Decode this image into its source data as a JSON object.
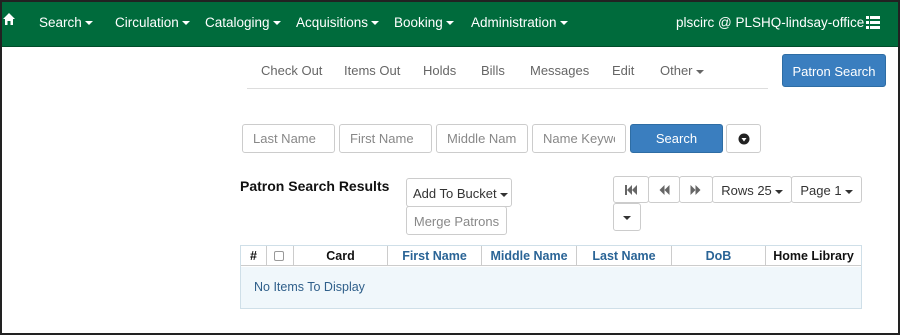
{
  "navbar": {
    "items": [
      {
        "label": "Search"
      },
      {
        "label": "Circulation"
      },
      {
        "label": "Cataloging"
      },
      {
        "label": "Acquisitions"
      },
      {
        "label": "Booking"
      },
      {
        "label": "Administration"
      }
    ],
    "user_label": "plscirc @ PLSHQ-lindsay-office",
    "bg_color": "#006b3c"
  },
  "subnav": {
    "items": [
      {
        "label": "Check Out"
      },
      {
        "label": "Items Out"
      },
      {
        "label": "Holds"
      },
      {
        "label": "Bills"
      },
      {
        "label": "Messages"
      },
      {
        "label": "Edit"
      },
      {
        "label": "Other"
      }
    ],
    "patron_search_label": "Patron Search"
  },
  "search_form": {
    "last_name_placeholder": "Last Name",
    "first_name_placeholder": "First Name",
    "middle_name_placeholder": "Middle Name",
    "name_keywords_placeholder": "Name Keywo",
    "search_label": "Search"
  },
  "results": {
    "title": "Patron Search Results",
    "add_to_bucket_label": "Add To Bucket",
    "merge_patrons_label": "Merge Patrons",
    "rows_label": "Rows 25",
    "page_label": "Page 1"
  },
  "grid": {
    "columns": [
      {
        "label": "#"
      },
      {
        "label": ""
      },
      {
        "label": "Card"
      },
      {
        "label": "First Name"
      },
      {
        "label": "Middle Name"
      },
      {
        "label": "Last Name"
      },
      {
        "label": "DoB"
      },
      {
        "label": "Home Library"
      }
    ],
    "empty_message": "No Items To Display"
  },
  "icons": {
    "home": "home-icon",
    "list": "list-icon",
    "download": "download-icon",
    "first_page": "first-page-icon",
    "prev_page": "previous-page-icon",
    "next_page": "next-page-icon"
  }
}
